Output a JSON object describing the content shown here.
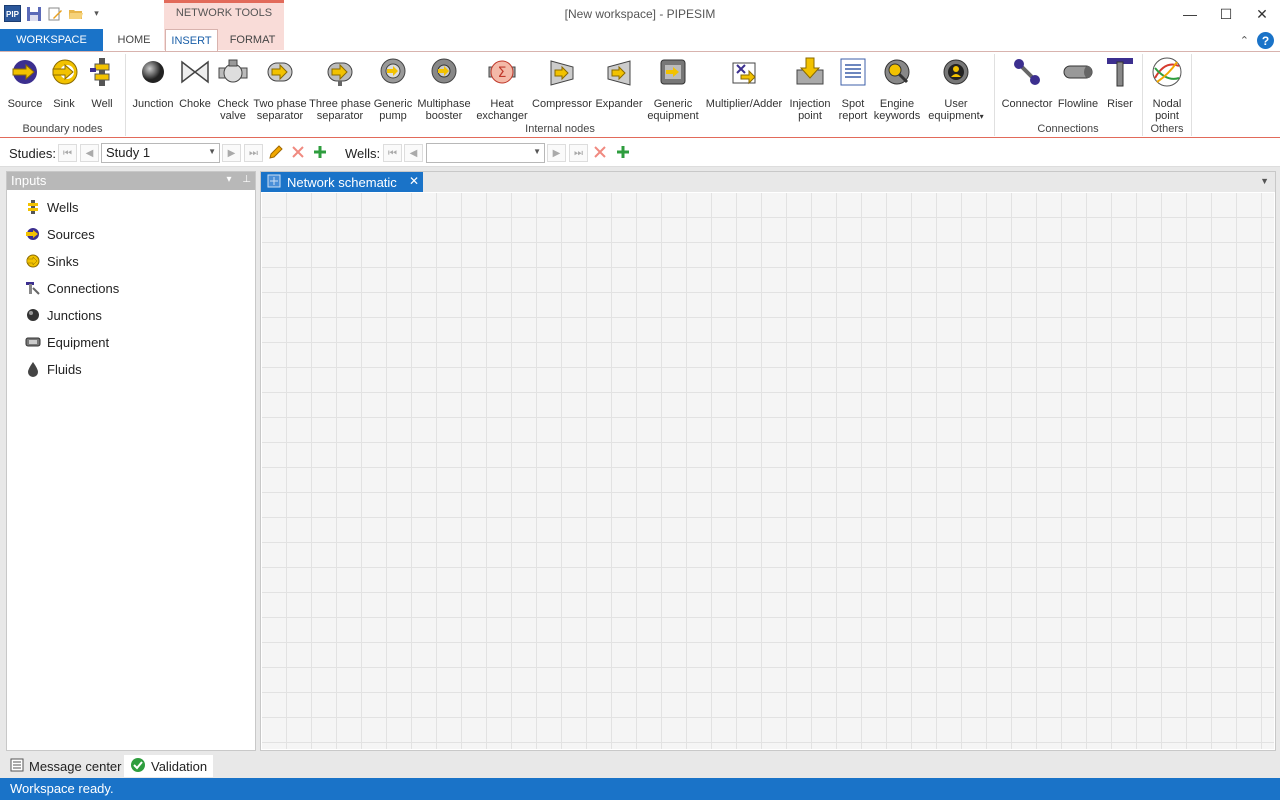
{
  "window": {
    "title": "[New workspace] - PIPESIM",
    "app_icon": "PIP",
    "context_tab_group": "NETWORK TOOLS"
  },
  "quick_access": [
    "save-icon",
    "edit-icon",
    "open-folder-icon",
    "customize-dropdown-icon"
  ],
  "tabs": {
    "workspace": "WORKSPACE",
    "home": "HOME",
    "insert": "INSERT",
    "format": "FORMAT"
  },
  "ribbon": {
    "boundary_nodes": {
      "label": "Boundary nodes",
      "items": [
        {
          "label": "Source",
          "icon": "source-icon"
        },
        {
          "label": "Sink",
          "icon": "sink-icon"
        },
        {
          "label": "Well",
          "icon": "well-icon"
        }
      ]
    },
    "internal_nodes": {
      "label": "Internal nodes",
      "items": [
        {
          "label1": "Junction",
          "label2": "",
          "icon": "junction-icon"
        },
        {
          "label1": "Choke",
          "label2": "",
          "icon": "choke-icon"
        },
        {
          "label1": "Check",
          "label2": "valve",
          "icon": "check-valve-icon"
        },
        {
          "label1": "Two phase",
          "label2": "separator",
          "icon": "two-phase-separator-icon"
        },
        {
          "label1": "Three phase",
          "label2": "separator",
          "icon": "three-phase-separator-icon"
        },
        {
          "label1": "Generic",
          "label2": "pump",
          "icon": "generic-pump-icon"
        },
        {
          "label1": "Multiphase",
          "label2": "booster",
          "icon": "multiphase-booster-icon"
        },
        {
          "label1": "Heat",
          "label2": "exchanger",
          "icon": "heat-exchanger-icon"
        },
        {
          "label1": "Compressor",
          "label2": "",
          "icon": "compressor-icon"
        },
        {
          "label1": "Expander",
          "label2": "",
          "icon": "expander-icon"
        },
        {
          "label1": "Generic",
          "label2": "equipment",
          "icon": "generic-equipment-icon"
        },
        {
          "label1": "Multiplier/Adder",
          "label2": "",
          "icon": "multiplier-adder-icon"
        },
        {
          "label1": "Injection",
          "label2": "point",
          "icon": "injection-point-icon"
        },
        {
          "label1": "Spot",
          "label2": "report",
          "icon": "spot-report-icon"
        },
        {
          "label1": "Engine",
          "label2": "keywords",
          "icon": "engine-keywords-icon"
        },
        {
          "label1": "User",
          "label2": "equipment",
          "icon": "user-equipment-icon"
        }
      ]
    },
    "connections": {
      "label": "Connections",
      "items": [
        {
          "label": "Connector",
          "icon": "connector-icon"
        },
        {
          "label": "Flowline",
          "icon": "flowline-icon"
        },
        {
          "label": "Riser",
          "icon": "riser-icon"
        }
      ]
    },
    "others": {
      "label": "Others",
      "items": [
        {
          "label1": "Nodal",
          "label2": "point",
          "icon": "nodal-point-icon"
        }
      ]
    }
  },
  "studies_bar": {
    "studies_label": "Studies:",
    "study_value": "Study 1",
    "wells_label": "Wells:",
    "wells_value": ""
  },
  "inputs_panel": {
    "title": "Inputs",
    "items": [
      {
        "label": "Wells",
        "icon": "wells-icon"
      },
      {
        "label": "Sources",
        "icon": "sources-icon"
      },
      {
        "label": "Sinks",
        "icon": "sinks-icon"
      },
      {
        "label": "Connections",
        "icon": "connections-icon"
      },
      {
        "label": "Junctions",
        "icon": "junctions-icon"
      },
      {
        "label": "Equipment",
        "icon": "equipment-icon"
      },
      {
        "label": "Fluids",
        "icon": "fluids-icon"
      }
    ]
  },
  "document": {
    "tab_label": "Network schematic"
  },
  "bottom_tabs": {
    "message_center": "Message center",
    "validation": "Validation"
  },
  "status": "Workspace ready.",
  "colors": {
    "accent": "#1a73c8",
    "context_tab": "#f9dcd8",
    "context_border": "#e26a5a",
    "grid_line": "#e2e2e2",
    "icon_yellow": "#f2c200",
    "icon_purple": "#3c2f8f"
  }
}
